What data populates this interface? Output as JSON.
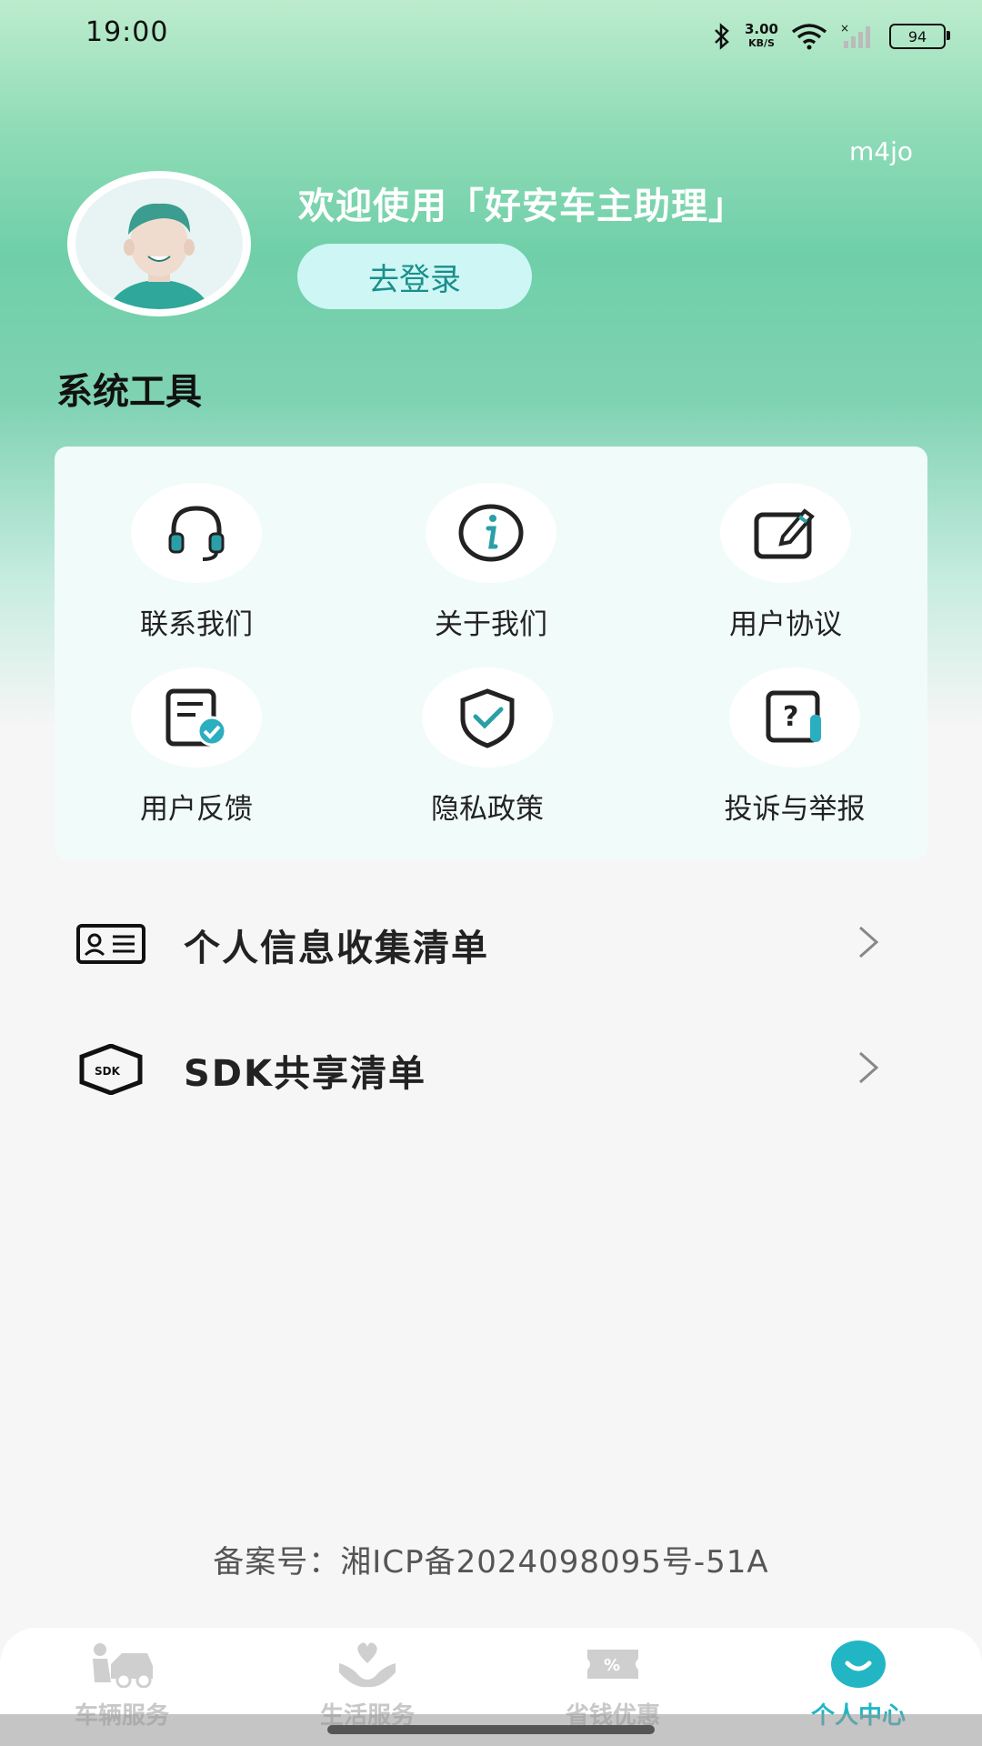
{
  "status_bar": {
    "time": "19:00",
    "net_speed_value": "3.00",
    "net_speed_unit": "KB/S",
    "battery": "94"
  },
  "header": {
    "user_tag": "m4jo",
    "welcome": "欢迎使用「好安车主助理」",
    "login_label": "去登录"
  },
  "tools": {
    "section_title": "系统工具",
    "items": [
      {
        "label": "联系我们",
        "icon": "headset-icon"
      },
      {
        "label": "关于我们",
        "icon": "info-icon"
      },
      {
        "label": "用户协议",
        "icon": "edit-icon"
      },
      {
        "label": "用户反馈",
        "icon": "feedback-icon"
      },
      {
        "label": "隐私政策",
        "icon": "shield-icon"
      },
      {
        "label": "投诉与举报",
        "icon": "question-report-icon"
      }
    ]
  },
  "list": [
    {
      "label": "个人信息收集清单",
      "icon": "id-card-icon"
    },
    {
      "label": "SDK共享清单",
      "icon": "sdk-icon"
    }
  ],
  "footer": {
    "icp": "备案号：湘ICP备2024098095号-51A"
  },
  "tabbar": {
    "tabs": [
      {
        "label": "车辆服务",
        "icon": "car-service-icon"
      },
      {
        "label": "生活服务",
        "icon": "life-service-icon"
      },
      {
        "label": "省钱优惠",
        "icon": "coupon-icon"
      },
      {
        "label": "个人中心",
        "icon": "profile-icon"
      }
    ],
    "active_index": 3,
    "active_color": "#22b6c4"
  }
}
